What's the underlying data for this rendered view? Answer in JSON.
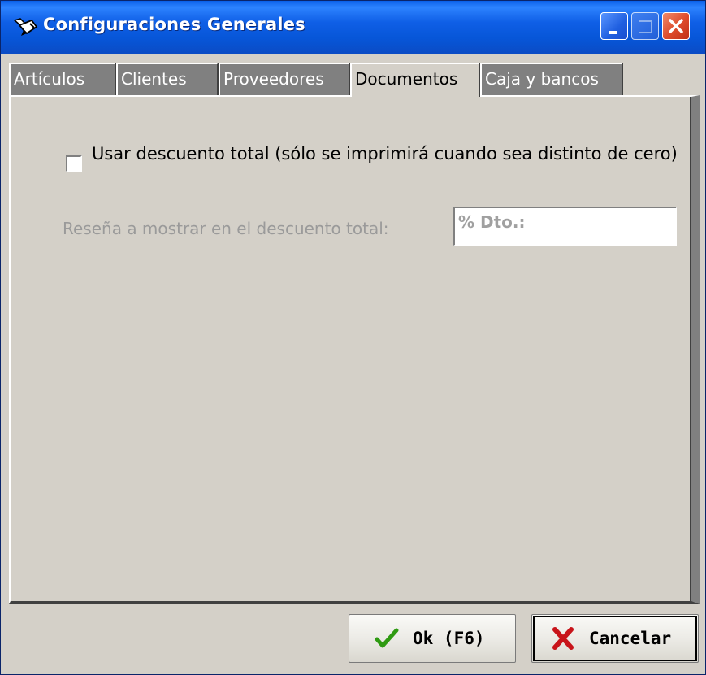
{
  "window": {
    "title": "Configuraciones Generales",
    "app_icon": "pen-icon"
  },
  "titlebar_buttons": [
    "minimize-icon",
    "maximize-icon",
    "close-icon"
  ],
  "tabs": [
    {
      "label": "Artículos",
      "active": false
    },
    {
      "label": "Clientes",
      "active": false
    },
    {
      "label": "Proveedores",
      "active": false
    },
    {
      "label": "Documentos",
      "active": true
    },
    {
      "label": "Caja y bancos",
      "active": false
    }
  ],
  "documentos": {
    "descuento_checkbox_label": "Usar descuento total (sólo se imprimirá cuando sea distinto de cero)",
    "descuento_checked": false,
    "resena_label": "Reseña a mostrar en el descuento total:",
    "resena_value": "% Dto.:",
    "resena_enabled": false
  },
  "buttons": {
    "ok_label": "Ok (F6)",
    "ok_icon": "checkmark-icon",
    "cancel_label": "Cancelar",
    "cancel_icon": "x-icon"
  },
  "colors": {
    "titlebar": "#0a5fe8",
    "ok_check": "#2f9a12",
    "cancel_x": "#c8141a",
    "close_button": "#dd4a2a"
  }
}
